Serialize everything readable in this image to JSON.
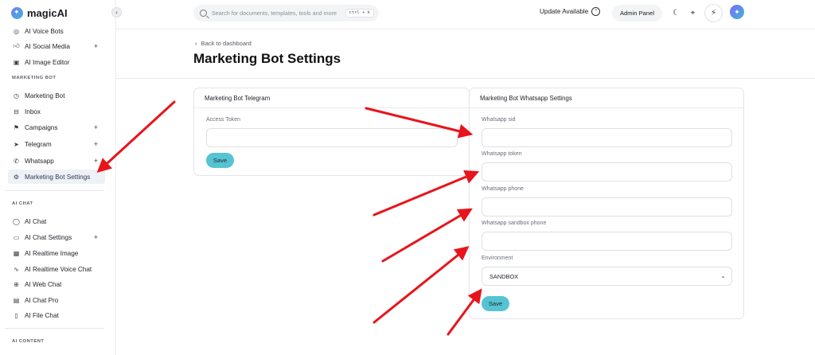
{
  "app": {
    "name": "magicAI"
  },
  "sidebar": {
    "items": [
      {
        "label": "AI Voice Bots",
        "icon": "voice-bot-icon",
        "plus": false
      },
      {
        "label": "AI Social Media",
        "icon": "thumbs-up-icon",
        "plus": true
      },
      {
        "label": "AI Image Editor",
        "icon": "image-edit-icon",
        "plus": false
      }
    ],
    "sections": [
      {
        "label": "MARKETING BOT",
        "items": [
          {
            "label": "Marketing Bot",
            "icon": "compass-icon",
            "plus": false
          },
          {
            "label": "Inbox",
            "icon": "inbox-icon",
            "plus": false
          },
          {
            "label": "Campaigns",
            "icon": "flag-icon",
            "plus": true
          },
          {
            "label": "Telegram",
            "icon": "telegram-icon",
            "plus": true
          },
          {
            "label": "Whatsapp",
            "icon": "whatsapp-icon",
            "plus": true
          },
          {
            "label": "Marketing Bot Settings",
            "icon": "settings-icon",
            "plus": false,
            "active": true
          }
        ]
      },
      {
        "label": "AI CHAT",
        "items": [
          {
            "label": "AI Chat",
            "icon": "chat-icon",
            "plus": false
          },
          {
            "label": "AI Chat Settings",
            "icon": "chat-settings-icon",
            "plus": true
          },
          {
            "label": "AI Realtime Image",
            "icon": "realtime-image-icon",
            "plus": false
          },
          {
            "label": "AI Realtime Voice Chat",
            "icon": "waveform-icon",
            "plus": false
          },
          {
            "label": "AI Web Chat",
            "icon": "globe-icon",
            "plus": false
          },
          {
            "label": "AI Chat Pro",
            "icon": "chat-pro-icon",
            "plus": false
          },
          {
            "label": "AI File Chat",
            "icon": "file-icon",
            "plus": false
          }
        ]
      },
      {
        "label": "AI CONTENT",
        "items": []
      }
    ]
  },
  "topbar": {
    "search_placeholder": "Search for documents, templates, tools and more",
    "shortcut": "ctrl + k",
    "update_label": "Update Available",
    "admin_label": "Admin Panel"
  },
  "page": {
    "back_label": "Back to dashboard",
    "title": "Marketing Bot Settings"
  },
  "telegram_card": {
    "title": "Marketing Bot Telegram",
    "fields": [
      {
        "label": "Access Token",
        "value": ""
      }
    ],
    "save_label": "Save"
  },
  "whatsapp_card": {
    "title": "Marketing Bot Whatsapp Settings",
    "fields": [
      {
        "label": "Whatsapp sid",
        "value": ""
      },
      {
        "label": "Whatsapp token",
        "value": ""
      },
      {
        "label": "Whatsapp phone",
        "value": ""
      },
      {
        "label": "Whatsapp sandbox phone",
        "value": ""
      }
    ],
    "environment_label": "Environment",
    "environment_value": "SANDBOX",
    "save_label": "Save"
  },
  "colors": {
    "accent": "#55c3d3",
    "annotation_arrow": "#e8141b",
    "active_bg": "#eef1f6"
  }
}
